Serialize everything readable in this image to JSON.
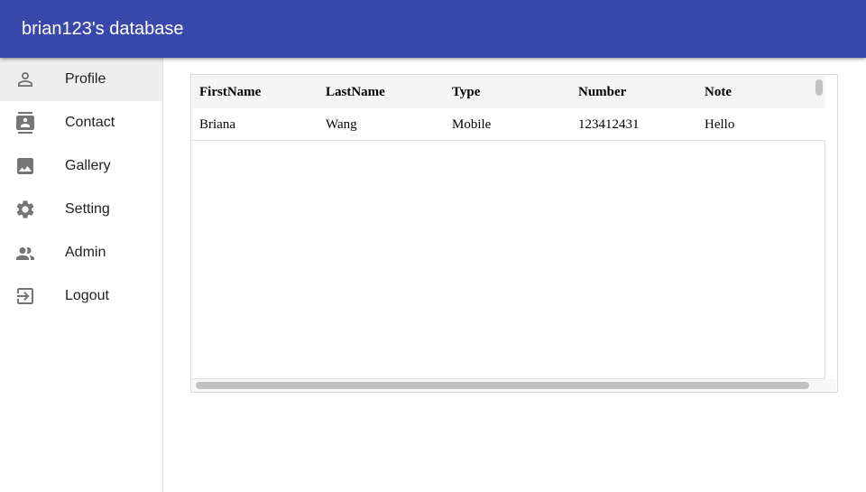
{
  "theme": {
    "primary": "#3949ab",
    "active_bg": "#eeeeee",
    "icon_color": "#757575"
  },
  "header": {
    "title": "brian123's database"
  },
  "sidebar": {
    "items": [
      {
        "label": "Profile",
        "icon": "person-icon",
        "active": true
      },
      {
        "label": "Contact",
        "icon": "contact-card-icon",
        "active": false
      },
      {
        "label": "Gallery",
        "icon": "image-icon",
        "active": false
      },
      {
        "label": "Setting",
        "icon": "gear-icon",
        "active": false
      },
      {
        "label": "Admin",
        "icon": "people-icon",
        "active": false
      },
      {
        "label": "Logout",
        "icon": "exit-icon",
        "active": false
      }
    ]
  },
  "table": {
    "columns": [
      "FirstName",
      "LastName",
      "Type",
      "Number",
      "Note"
    ],
    "rows": [
      [
        "Briana",
        "Wang",
        "Mobile",
        "123412431",
        "Hello"
      ]
    ]
  }
}
